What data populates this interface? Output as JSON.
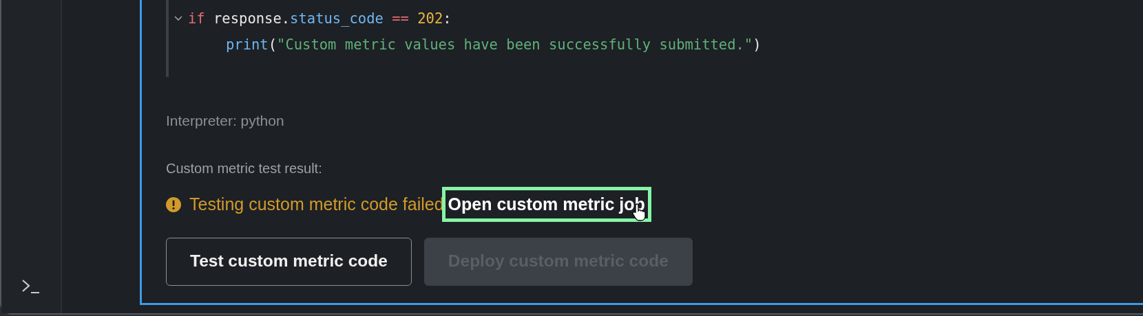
{
  "code": {
    "lines": [
      {
        "expanded": true,
        "tokens": [
          {
            "kind": "keyword",
            "text": "if"
          },
          {
            "kind": "plain",
            "text": " response."
          },
          {
            "kind": "attr",
            "text": "status_code"
          },
          {
            "kind": "operator",
            "text": " =="
          },
          {
            "kind": "number",
            "text": " 202"
          },
          {
            "kind": "plain",
            "text": ":"
          }
        ],
        "children": [
          {
            "tokens": [
              {
                "kind": "func",
                "text": "print"
              },
              {
                "kind": "plain",
                "text": "("
              },
              {
                "kind": "string",
                "text": "\"Custom metric values have been successfully submitted.\""
              },
              {
                "kind": "plain",
                "text": ")"
              }
            ]
          }
        ]
      }
    ]
  },
  "interpreter": "Interpreter: python",
  "result_label": "Custom metric test result:",
  "result": {
    "kind": "warning",
    "message": "Testing custom metric code failed",
    "link": {
      "label": "Open custom metric job",
      "focused": true
    }
  },
  "buttons": [
    {
      "label": "Test custom metric code",
      "disabled": false
    },
    {
      "label": "Deploy custom metric code",
      "disabled": true
    }
  ]
}
